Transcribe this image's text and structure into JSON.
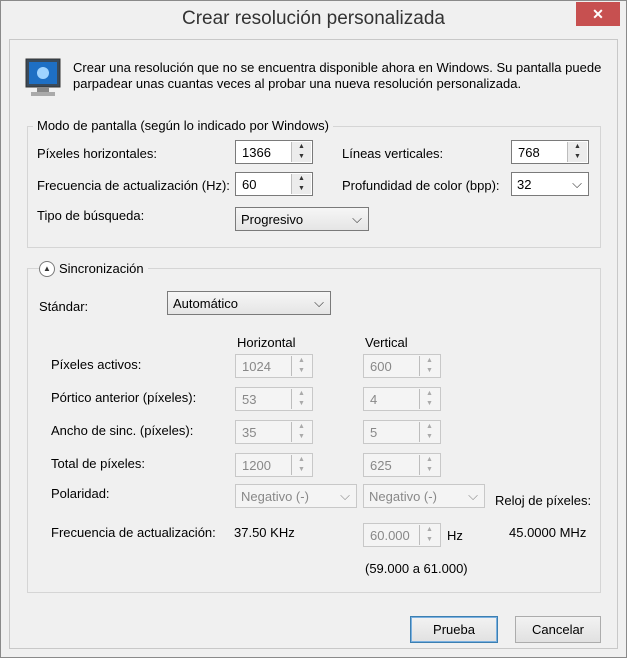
{
  "window": {
    "title": "Crear resolución personalizada",
    "close_glyph": "✕"
  },
  "description": "Crear una resolución que no se encuentra disponible ahora en Windows. Su pantalla puede parpadear unas cuantas veces al probar una nueva resolución personalizada.",
  "icon": "monitor-icon",
  "mode": {
    "legend": "Modo de pantalla (según lo indicado por Windows)",
    "h_pixels_label": "Píxeles horizontales:",
    "h_pixels_value": "1366",
    "v_lines_label": "Líneas verticales:",
    "v_lines_value": "768",
    "refresh_label": "Frecuencia de actualización (Hz):",
    "refresh_value": "60",
    "depth_label": "Profundidad de color (bpp):",
    "depth_value": "32",
    "scan_label": "Tipo de búsqueda:",
    "scan_value": "Progresivo"
  },
  "sync": {
    "legend": "Sincronización",
    "standard_label": "Stándar:",
    "standard_value": "Automático",
    "col_h": "Horizontal",
    "col_v": "Vertical",
    "active_label": "Píxeles activos:",
    "active_h": "1024",
    "active_v": "600",
    "porch_label": "Pórtico anterior (píxeles):",
    "porch_h": "53",
    "porch_v": "4",
    "width_label": "Ancho de sinc. (píxeles):",
    "width_h": "35",
    "width_v": "5",
    "total_label": "Total de píxeles:",
    "total_h": "1200",
    "total_v": "625",
    "polarity_label": "Polaridad:",
    "polarity_h": "Negativo (-)",
    "polarity_v": "Negativo (-)",
    "clock_label": "Reloj de píxeles:",
    "clock_value": "45.0000 MHz",
    "refresh_label": "Frecuencia de actualización:",
    "refresh_h": "37.50 KHz",
    "refresh_v": "60.000",
    "refresh_unit": "Hz",
    "range": "(59.000 a 61.000)"
  },
  "buttons": {
    "test": "Prueba",
    "cancel": "Cancelar"
  }
}
